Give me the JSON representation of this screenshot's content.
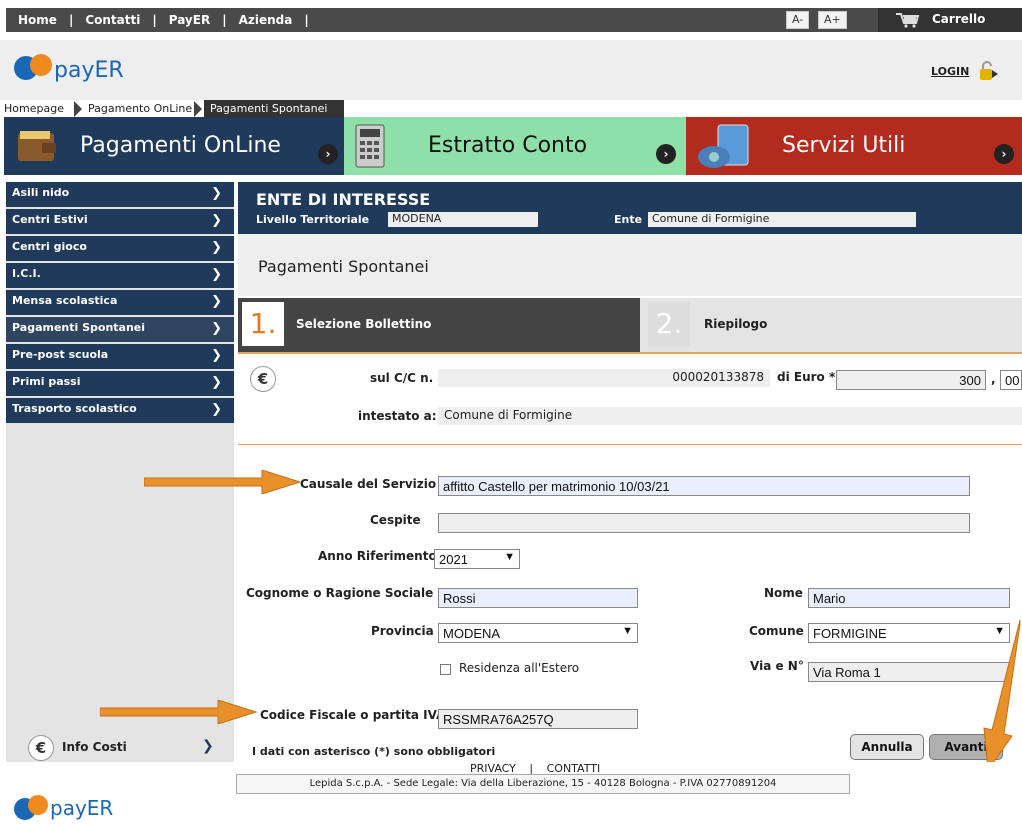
{
  "topnav": {
    "links": [
      "Home",
      "Contatti",
      "PayER",
      "Azienda"
    ],
    "font_minus": "A-",
    "font_plus": "A+",
    "cart_label": "Carrello"
  },
  "logo": {
    "text": "payER"
  },
  "login_label": "LOGIN",
  "breadcrumb": [
    "Homepage",
    "Pagamento OnLine",
    "Pagamenti Spontanei"
  ],
  "banners": [
    {
      "label": "Pagamenti OnLine",
      "color": "#1f3a5a"
    },
    {
      "label": "Estratto Conto",
      "color": "#8fe0a8"
    },
    {
      "label": "Servizi Utili",
      "color": "#b32a1e"
    }
  ],
  "sidebar": {
    "items": [
      {
        "label": "Asili nido"
      },
      {
        "label": "Centri Estivi"
      },
      {
        "label": "Centri gioco"
      },
      {
        "label": "I.C.I."
      },
      {
        "label": "Mensa scolastica"
      },
      {
        "label": "Pagamenti Spontanei",
        "active": true
      },
      {
        "label": "Pre-post scuola"
      },
      {
        "label": "Primi passi"
      },
      {
        "label": "Trasporto scolastico"
      }
    ],
    "info_costi": "Info Costi"
  },
  "ente": {
    "heading": "ENTE DI INTERESSE",
    "livello_label": "Livello Territoriale",
    "livello_value": "MODENA",
    "ente_label": "Ente",
    "ente_value": "Comune di Formigine"
  },
  "page_title": "Pagamenti Spontanei",
  "steps": [
    {
      "num": "1.",
      "label": "Selezione Bollettino"
    },
    {
      "num": "2.",
      "label": "Riepilogo"
    }
  ],
  "form": {
    "cc_label": "sul C/C n.",
    "cc_value": "000020133878",
    "euro_label": "di Euro *",
    "euro_value": "300",
    "cents_value": "00",
    "intestato_label": "intestato a:",
    "intestato_value": "Comune di Formigine",
    "causale_label": "Causale del Servizio",
    "causale_value": "affitto Castello per matrimonio 10/03/21",
    "cespite_label": "Cespite",
    "cespite_value": "",
    "anno_label": "Anno Riferimento",
    "anno_value": "2021",
    "cognome_label": "Cognome o Ragione Sociale",
    "cognome_value": "Rossi",
    "nome_label": "Nome",
    "nome_value": "Mario",
    "provincia_label": "Provincia",
    "provincia_value": "MODENA",
    "comune_label": "Comune",
    "comune_value": "FORMIGINE",
    "residenza_label": "Residenza all'Estero",
    "via_label": "Via e N°",
    "via_value": "Via Roma 1",
    "cf_label": "Codice Fiscale o partita IVA",
    "cf_value": "RSSMRA76A257Q",
    "obbligatori_note": "I dati con asterisco (*) sono obbligatori",
    "annulla_label": "Annulla",
    "avanti_label": "Avanti"
  },
  "footer": {
    "privacy": "PRIVACY",
    "contatti": "CONTATTI",
    "company": "Lepida S.c.p.A. - Sede Legale: Via della Liberazione, 15 - 40128 Bologna - P.IVA 02770891204"
  },
  "colors": {
    "accent_orange": "#e8902a",
    "navy": "#1f3a5a"
  }
}
